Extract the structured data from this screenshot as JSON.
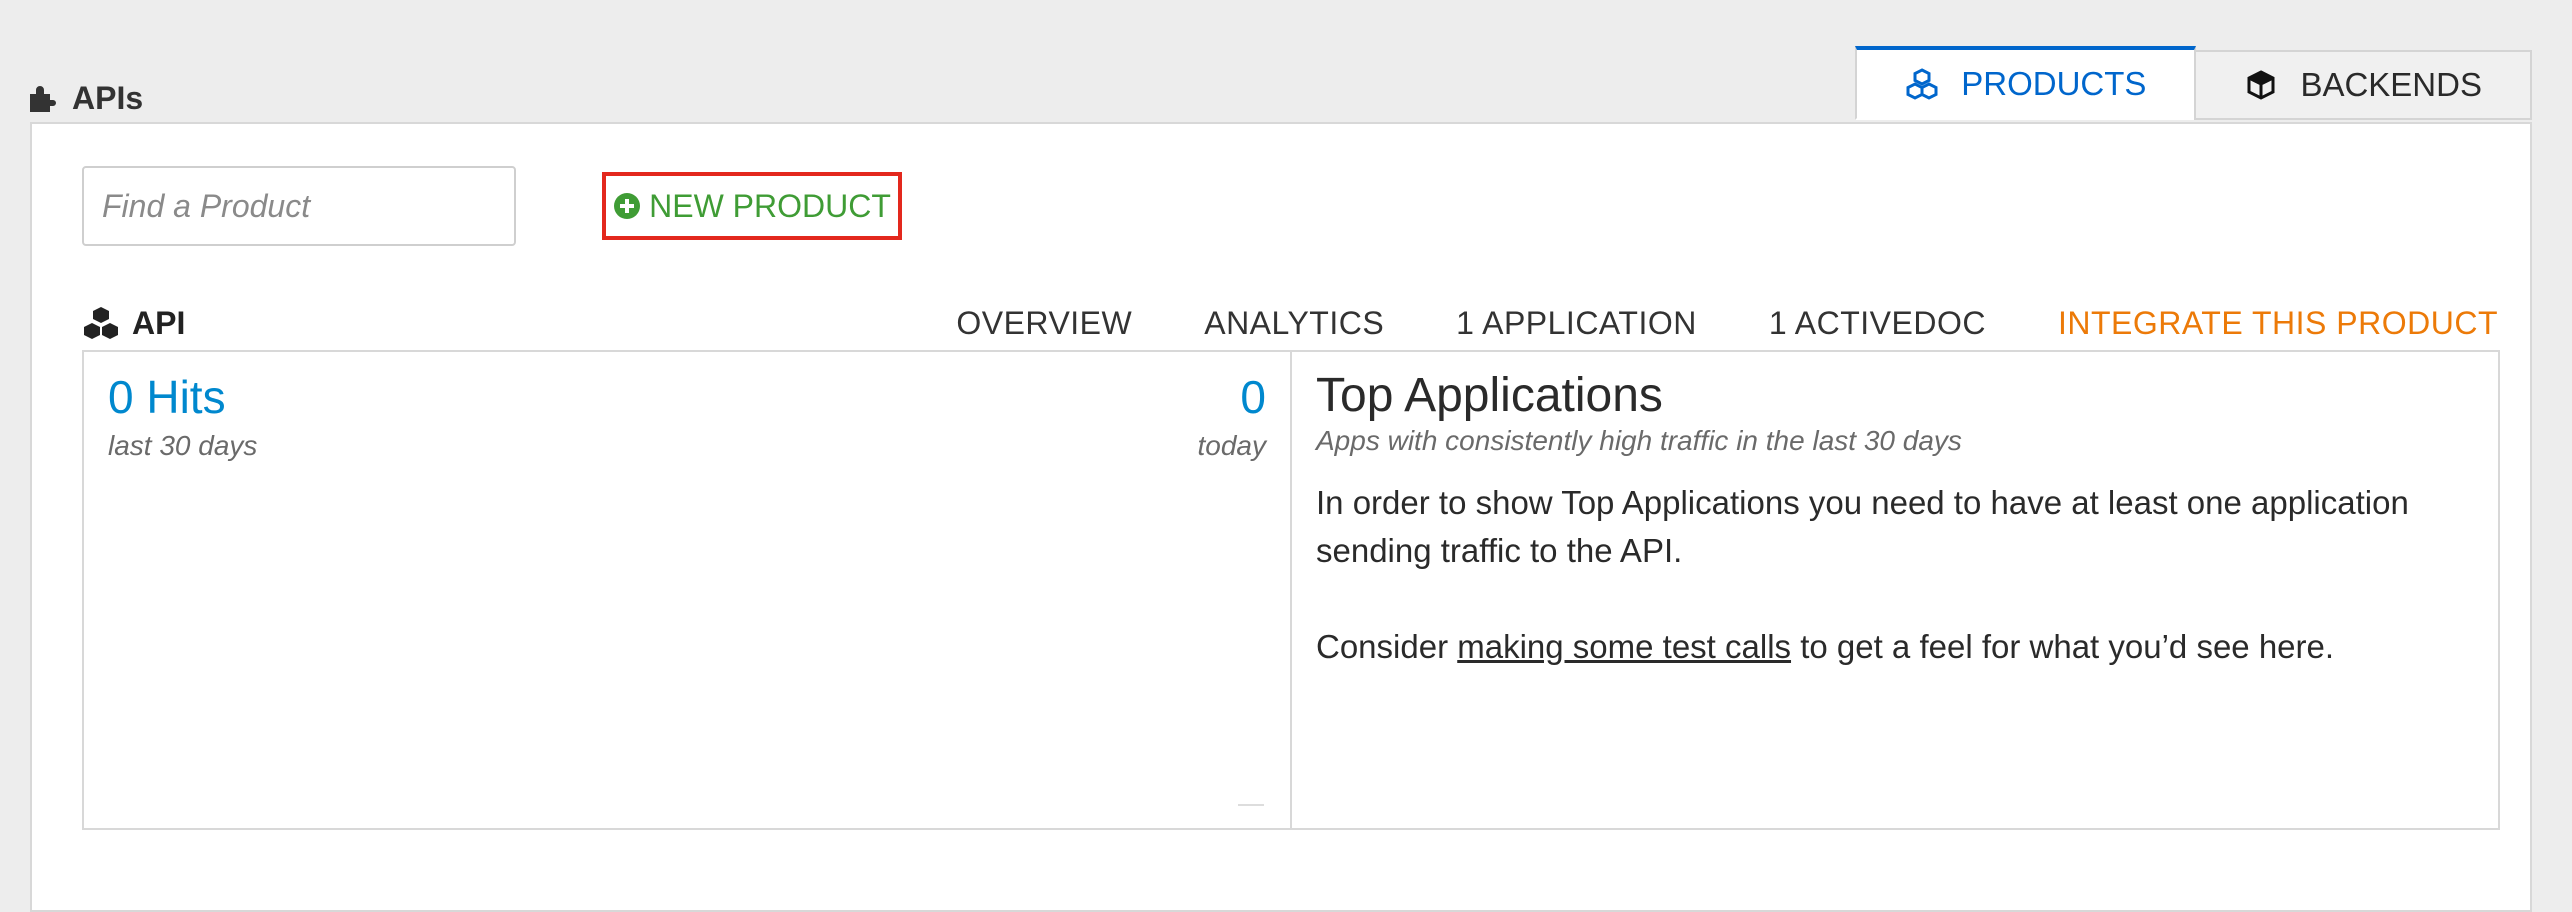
{
  "section": {
    "title": "APIs",
    "icon": "puzzle-icon"
  },
  "tabs": [
    {
      "label": "PRODUCTS",
      "icon": "cubes-icon",
      "active": true
    },
    {
      "label": "BACKENDS",
      "icon": "cube-icon",
      "active": false
    }
  ],
  "search": {
    "placeholder": "Find a Product",
    "value": ""
  },
  "new_product": {
    "label": "NEW PRODUCT"
  },
  "product": {
    "name": "API",
    "nav": [
      "OVERVIEW",
      "ANALYTICS",
      "1 APPLICATION",
      "1 ACTIVEDOC"
    ],
    "integrate": "INTEGRATE THIS PRODUCT"
  },
  "hits": {
    "total": "0 Hits",
    "total_caption": "last 30 days",
    "today": "0",
    "today_caption": "today"
  },
  "top_apps": {
    "title": "Top Applications",
    "subtitle": "Apps with consistently high traffic in the last 30 days",
    "message": "In order to show Top Applications you need to have at least one application sending traffic to the API.",
    "consider_prefix": "Consider ",
    "link_text": "making some test calls",
    "consider_suffix": " to get a feel for what you’d see here."
  },
  "colors": {
    "accent": "#0066cc",
    "success": "#3f9c35",
    "warning": "#ec7a08",
    "highlight": "#e3281d",
    "hits": "#0088ce"
  }
}
